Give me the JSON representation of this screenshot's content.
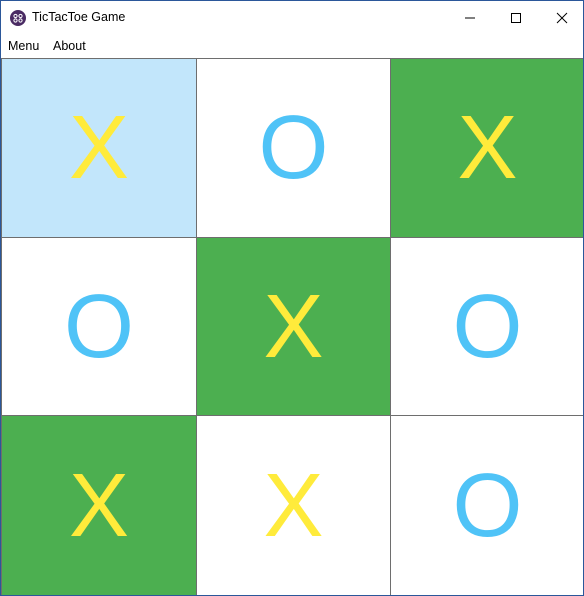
{
  "window": {
    "title": "TicTacToe Game",
    "app_icon": "game-controller-icon"
  },
  "menu": {
    "items": [
      "Menu",
      "About"
    ]
  },
  "board": {
    "cells": [
      {
        "mark": "X",
        "color": "#c2e6fb"
      },
      {
        "mark": "O",
        "color": "#ffffff"
      },
      {
        "mark": "X",
        "color": "#4caf50"
      },
      {
        "mark": "O",
        "color": "#ffffff"
      },
      {
        "mark": "X",
        "color": "#4caf50"
      },
      {
        "mark": "O",
        "color": "#ffffff"
      },
      {
        "mark": "X",
        "color": "#4caf50"
      },
      {
        "mark": "X",
        "color": "#ffffff"
      },
      {
        "mark": "O",
        "color": "#ffffff"
      }
    ]
  },
  "colors": {
    "x_mark": "#ffeb3b",
    "o_mark": "#4fc3f7",
    "grid_line": "#6e6e6e",
    "selected_cell": "#c2e6fb",
    "winning_cell": "#4caf50"
  }
}
